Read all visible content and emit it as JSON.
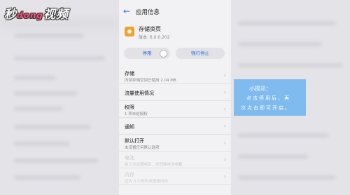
{
  "watermark": {
    "left": "秒",
    "mid": "dong",
    "right": "视频"
  },
  "header": {
    "title": "应用信息",
    "back_icon": "arrow-left-icon"
  },
  "app": {
    "name": "存储资页",
    "version": "版本: 6.0.0.202"
  },
  "buttons": {
    "disable": "停用",
    "force_stop": "强行停止"
  },
  "items": [
    {
      "title": "存储",
      "subtitle": "内部存储空间已使用 2.04 MB",
      "enabled": true
    },
    {
      "title": "流量使用情况",
      "subtitle": "",
      "enabled": true
    },
    {
      "title": "权限",
      "subtitle": "1 项未给授权",
      "enabled": true
    },
    {
      "title": "通知",
      "subtitle": "",
      "enabled": true
    },
    {
      "title": "默认打开",
      "subtitle": "未设置任何默认选项",
      "enabled": true
    },
    {
      "title": "电池",
      "subtitle": "自上次充满电后，未消耗电池电量",
      "enabled": false
    },
    {
      "title": "内存",
      "subtitle": "过去 3 小时内未使用内存",
      "enabled": false
    }
  ],
  "tip": {
    "head": "小提示：",
    "line1": "点击停用后，再",
    "line2": "次点击即可开启。"
  },
  "colors": {
    "accent": "#2f6fd6",
    "tip_bg": "#7fbbef",
    "app_icon": "#f0a030"
  }
}
